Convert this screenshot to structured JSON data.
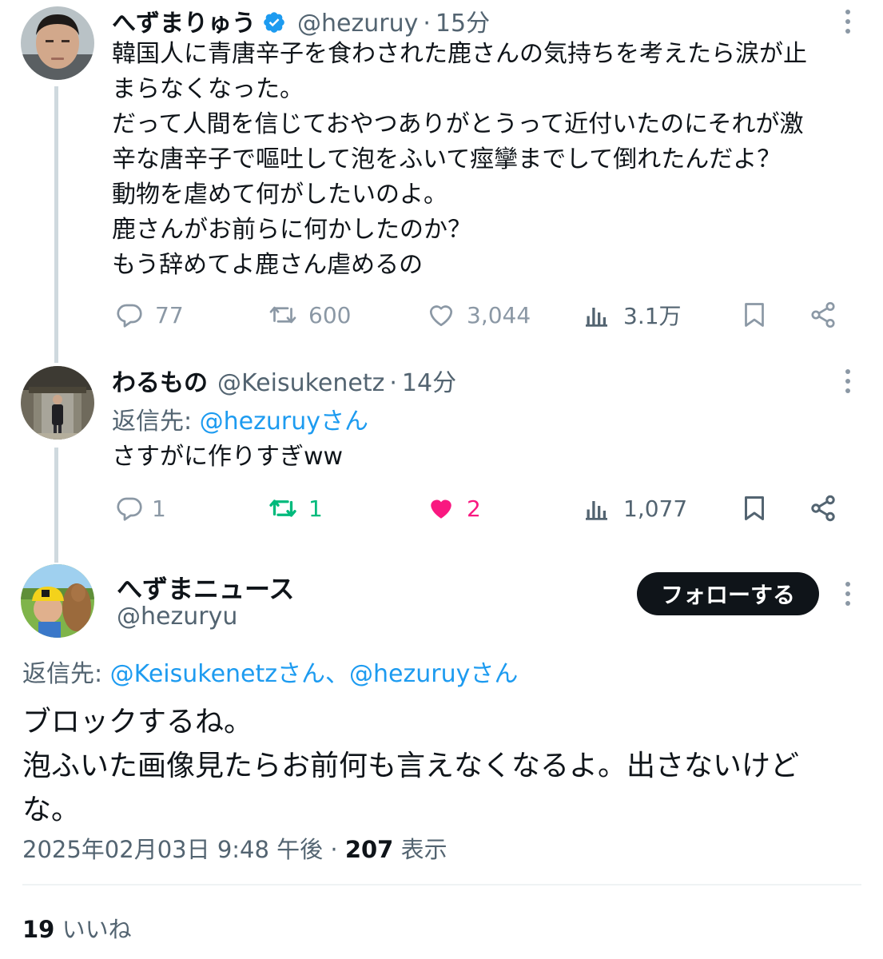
{
  "thread": [
    {
      "name": "へずまりゅう",
      "handle": "@hezuruy",
      "time": "15分",
      "verified": true,
      "text": "韓国人に青唐辛子を食わされた鹿さんの気持ちを考えたら涙が止\nまらなくなった。\nだって人間を信じておやつありがとうって近付いたのにそれが激\n辛な唐辛子で嘔吐して泡をふいて痙攣までして倒れたんだよ？\n動物を虐めて何がしたいのよ。\n鹿さんがお前らに何かしたのか？\nもう辞めてよ鹿さん虐めるの",
      "replies": "77",
      "retweets": "600",
      "likes": "3,044",
      "views": "3.1万"
    },
    {
      "name": "わるもの",
      "handle": "@Keisukenetz",
      "time": "14分",
      "reply_prefix": "返信先: ",
      "reply_target": "@hezuruyさん",
      "text": "さすがに作りすぎww",
      "replies": "1",
      "retweets": "1",
      "likes": "2",
      "views": "1,077"
    }
  ],
  "main": {
    "name": "へずまニュース",
    "handle": "@hezuryu",
    "follow_label": "フォローする",
    "reply_prefix": "返信先: ",
    "reply_targets": "@Keisukenetzさん、@hezuruyさん",
    "text": "ブロックするね。\n泡ふいた画像見たらお前何も言えなくなるよ。出さないけど\nな。",
    "timestamp": "2025年02月03日 9:48 午後",
    "views_count": "207",
    "views_label": "表示",
    "likes_count": "19",
    "likes_label": "いいね"
  },
  "colors": {
    "accent": "#1d9bf0",
    "retweet_active": "#00ba7c",
    "like_active": "#f91880",
    "muted": "#536471"
  },
  "icons": [
    "reply-icon",
    "retweet-icon",
    "like-icon",
    "views-icon",
    "bookmark-icon",
    "share-icon",
    "more-icon",
    "verified-icon"
  ]
}
